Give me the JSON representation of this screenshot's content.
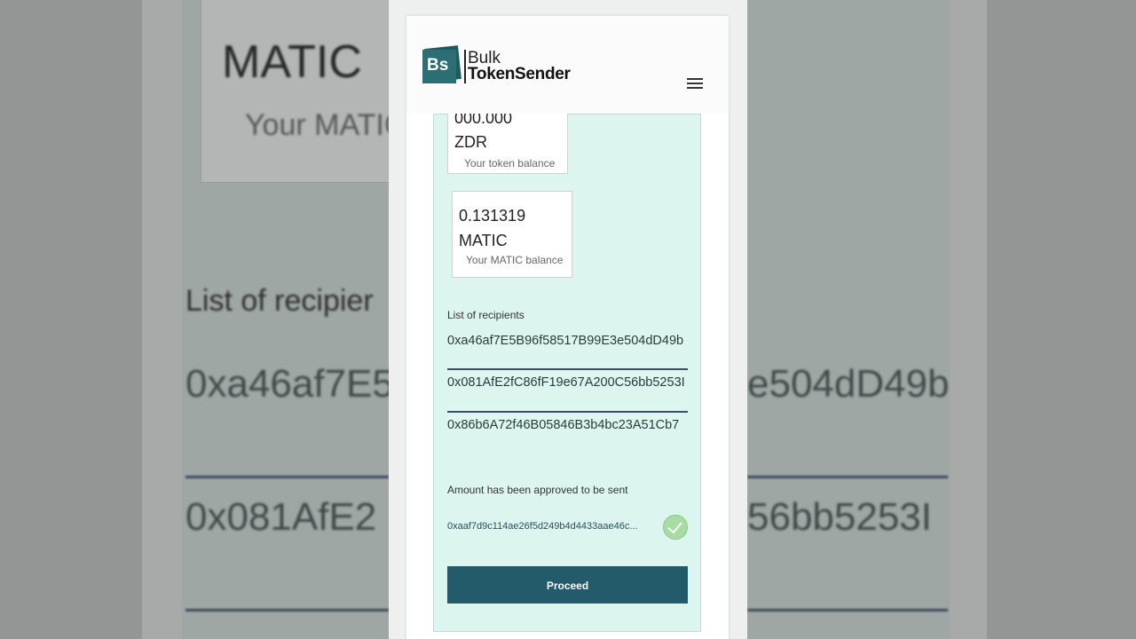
{
  "brand": {
    "logo_text": "Bs",
    "line1": "Bulk",
    "line2": "TokenSender"
  },
  "balances": {
    "token": {
      "value_partial": "000.000",
      "symbol": "ZDR",
      "caption": "Your token balance"
    },
    "matic": {
      "value": "0.131319",
      "symbol": "MATIC",
      "caption": "Your MATIC balance"
    }
  },
  "recipients": {
    "label": "List of recipients",
    "items": [
      "0xa46af7E5B96f58517B99E3e504dD49b",
      "0x081AfE2fC86fF19e67A200C56bb5253I",
      "0x86b6A72f46B05846B3b4bc23A51Cb7"
    ]
  },
  "approval": {
    "label": "Amount has been approved to be sent",
    "tx_hash": "0xaaf7d9c114ae26f5d249b4d4433aae46c..."
  },
  "proceed_label": "Proceed",
  "background": {
    "matic": "MATIC",
    "your_matic": "Your MATIC",
    "list_label": "List of recipier",
    "addr1_left": "0xa46af7E5",
    "addr1_right": "e504dD49b",
    "addr2_left": "0x081AfE2",
    "addr2_right": "56bb5253I"
  },
  "colors": {
    "accent": "#245b6a",
    "panel": "#dcf5ef",
    "success": "#a8dca4"
  }
}
